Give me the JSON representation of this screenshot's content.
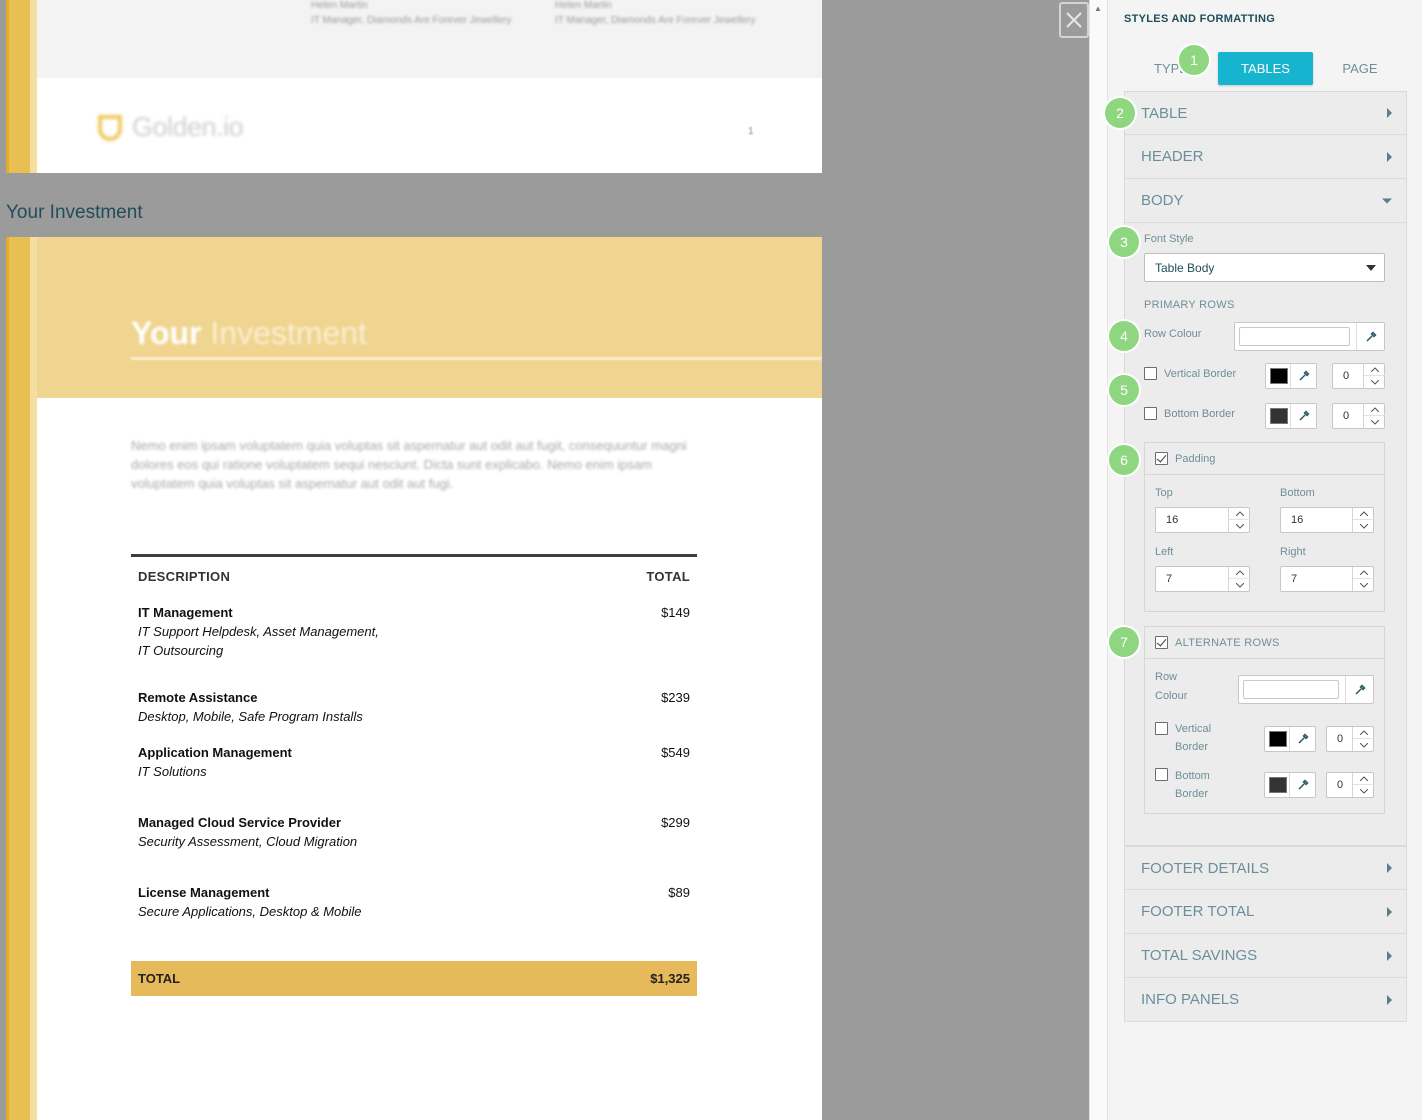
{
  "preview": {
    "signature": [
      {
        "name": "Helen Martin",
        "role": "IT Manager, Diamonds Are Forever Jewellery"
      },
      {
        "name": "Helen Martin",
        "role": "IT Manager, Diamonds Are Forever Jewellery"
      }
    ],
    "logo_text": "Golden.io",
    "page_number": "1",
    "section_label": "Your Investment",
    "hero_title_bold": "Your",
    "hero_title_light": "Investment",
    "lorem": "Nemo enim ipsam voluptatem quia voluptas sit aspernatur aut odit aut fugit, consequuntur magni dolores eos qui ratione voluptatem sequi nesciunt. Dicta sunt explicabo. Nemo enim ipsam voluptatem quia voluptas sit aspernatur aut odit aut fugi.",
    "table": {
      "col_description": "DESCRIPTION",
      "col_total": "TOTAL",
      "rows": [
        {
          "name": "IT Management",
          "desc1": "IT Support Helpdesk, Asset Management,",
          "desc2": "IT Outsourcing",
          "price": "$149"
        },
        {
          "name": "Remote Assistance",
          "desc1": "Desktop, Mobile, Safe Program Installs",
          "desc2": "",
          "price": "$239"
        },
        {
          "name": "Application Management",
          "desc1": "IT Solutions",
          "desc2": "",
          "price": "$549"
        },
        {
          "name": "Managed Cloud Service Provider",
          "desc1": "Security Assessment, Cloud Migration",
          "desc2": "",
          "price": "$299"
        },
        {
          "name": "License Management",
          "desc1": "Secure Applications, Desktop & Mobile",
          "desc2": "",
          "price": "$89"
        }
      ],
      "total_label": "TOTAL",
      "total_value": "$1,325"
    }
  },
  "panel": {
    "title": "STYLES AND FORMATTING",
    "tabs": [
      {
        "label": "TYPE",
        "active": false
      },
      {
        "label": "TABLES",
        "active": true
      },
      {
        "label": "PAGE",
        "active": false
      }
    ],
    "sections": {
      "table": "TABLE",
      "header": "HEADER",
      "body": "BODY",
      "footer_details": "FOOTER DETAILS",
      "footer_total": "FOOTER TOTAL",
      "total_savings": "TOTAL SAVINGS",
      "info_panels": "INFO PANELS"
    },
    "body": {
      "font_style_label": "Font Style",
      "font_style_value": "Table Body",
      "primary_rows_label": "PRIMARY ROWS",
      "row_colour_label": "Row Colour",
      "vertical_border_label": "Vertical Border",
      "vertical_border_value": "0",
      "vertical_border_color": "#000000",
      "bottom_border_label": "Bottom Border",
      "bottom_border_value": "0",
      "bottom_border_color": "#333333",
      "padding_label": "Padding",
      "padding_checked": true,
      "padding": {
        "top_label": "Top",
        "top": "16",
        "bottom_label": "Bottom",
        "bottom": "16",
        "left_label": "Left",
        "left": "7",
        "right_label": "Right",
        "right": "7"
      },
      "alternate_rows_label": "ALTERNATE ROWS",
      "alternate_checked": true,
      "alt_row_label_1": "Row",
      "alt_row_label_2": "Colour",
      "alt_vertical_label_1": "Vertical",
      "alt_vertical_label_2": "Border",
      "alt_vertical_value": "0",
      "alt_bottom_label_1": "Bottom",
      "alt_bottom_label_2": "Border",
      "alt_bottom_value": "0"
    },
    "badges": [
      "1",
      "2",
      "3",
      "4",
      "5",
      "6",
      "7"
    ]
  },
  "colors": {
    "accent": "#17b4d0",
    "badge": "#8fd680",
    "gold": "#e6b95a"
  }
}
